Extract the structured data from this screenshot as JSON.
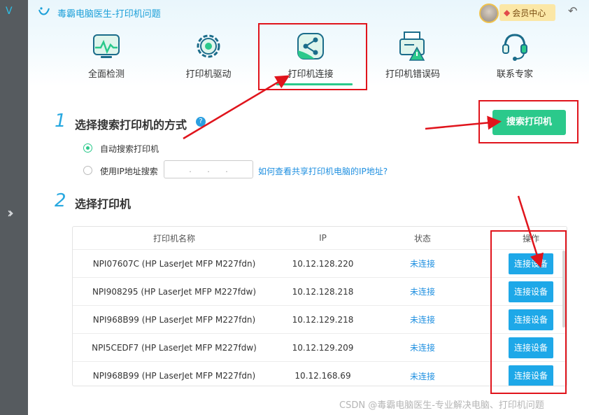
{
  "window": {
    "title": "毒霸电脑医生-打印机问题",
    "vip_label": "会员中心",
    "back_icon": "undo-arrow-icon"
  },
  "tabs": [
    {
      "label": "全面检测",
      "icon": "pulse-monitor-icon",
      "active": false
    },
    {
      "label": "打印机驱动",
      "icon": "gear-icon",
      "active": false
    },
    {
      "label": "打印机连接",
      "icon": "share-icon",
      "active": true
    },
    {
      "label": "打印机错误码",
      "icon": "printer-warning-icon",
      "active": false
    },
    {
      "label": "联系专家",
      "icon": "headset-icon",
      "active": false
    }
  ],
  "step1": {
    "number": "1",
    "title": "选择搜索打印机的方式",
    "help_icon": "?",
    "options": [
      {
        "label": "自动搜索打印机",
        "selected": true
      },
      {
        "label": "使用IP地址搜索",
        "selected": false
      }
    ],
    "ip_dots": [
      ".",
      ".",
      "."
    ],
    "help_link": "如何查看共享打印机电脑的IP地址?",
    "search_button": "搜索打印机"
  },
  "step2": {
    "number": "2",
    "title": "选择打印机"
  },
  "table": {
    "headers": [
      "打印机名称",
      "IP",
      "状态",
      "操作"
    ],
    "rows": [
      {
        "name": "NPI07607C (HP LaserJet MFP M227fdn)",
        "ip": "10.12.128.220",
        "status": "未连接",
        "action": "连接设备"
      },
      {
        "name": "NPI908295 (HP LaserJet MFP M227fdw)",
        "ip": "10.12.128.218",
        "status": "未连接",
        "action": "连接设备"
      },
      {
        "name": "NPI968B99 (HP LaserJet MFP M227fdn)",
        "ip": "10.12.129.218",
        "status": "未连接",
        "action": "连接设备"
      },
      {
        "name": "NPI5CEDF7 (HP LaserJet MFP M227fdw)",
        "ip": "10.12.129.209",
        "status": "未连接",
        "action": "连接设备"
      },
      {
        "name": "NPI968B99 (HP LaserJet MFP M227fdn)",
        "ip": "10.12.168.69",
        "status": "未连接",
        "action": "连接设备"
      }
    ]
  },
  "watermark": "CSDN @毒霸电脑医生-专业解决电脑、打印机问题",
  "colors": {
    "accent_green": "#2bc98b",
    "accent_blue": "#1ea8e8",
    "annotation_red": "#e0141c"
  }
}
